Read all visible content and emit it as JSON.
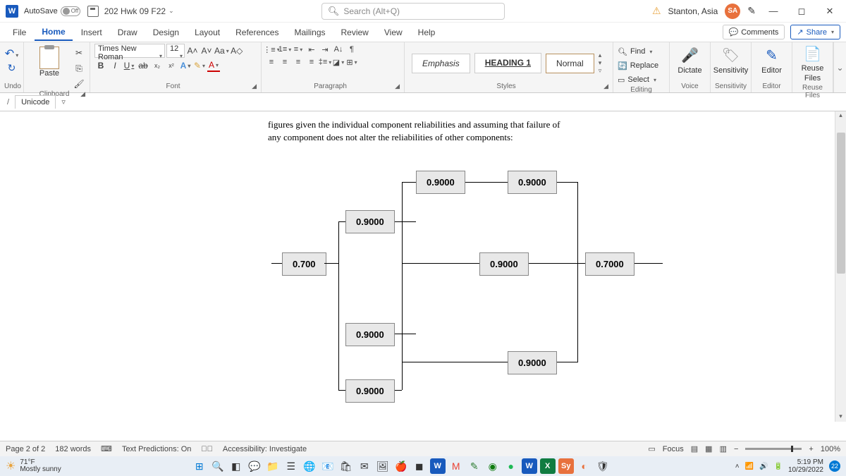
{
  "titlebar": {
    "autosave_label": "AutoSave",
    "autosave_state": "Off",
    "doc_name": "202 Hwk 09 F22",
    "search_placeholder": "Search (Alt+Q)",
    "username": "Stanton, Asia",
    "avatar_initials": "SA"
  },
  "tabs": {
    "file": "File",
    "home": "Home",
    "insert": "Insert",
    "draw": "Draw",
    "design": "Design",
    "layout": "Layout",
    "references": "References",
    "mailings": "Mailings",
    "review": "Review",
    "view": "View",
    "help": "Help",
    "comments": "Comments",
    "share": "Share"
  },
  "ribbon": {
    "undo_label": "Undo",
    "clipboard_label": "Clipboard",
    "paste": "Paste",
    "font_label": "Font",
    "font_name": "Times New Roman",
    "font_size": "12",
    "bold": "B",
    "italic": "I",
    "underline": "U",
    "strike": "ab",
    "sub": "x₂",
    "sup": "x²",
    "grow": "A˄",
    "shrink": "A˅",
    "case": "Aa",
    "clear": "A◇",
    "text_effect": "A",
    "highlight": "✎",
    "font_color": "A",
    "paragraph_label": "Paragraph",
    "styles_label": "Styles",
    "styles": {
      "emphasis": "Emphasis",
      "heading1": "HEADING 1",
      "normal": "Normal"
    },
    "editing_label": "Editing",
    "find": "Find",
    "replace": "Replace",
    "select": "Select",
    "dictate": "Dictate",
    "voice": "Voice",
    "sensitivity": "Sensitivity",
    "sensitivity_label": "Sensitivity",
    "editor": "Editor",
    "editor_label": "Editor",
    "reuse": "Reuse",
    "reuse2": "Files",
    "reuse_label": "Reuse Files"
  },
  "subtab": {
    "unicode": "Unicode"
  },
  "document": {
    "paragraph": "figures given the individual component reliabilities and assuming that failure of any component does not alter the reliabilities of other components:",
    "boxes": {
      "b1": "0.9000",
      "b2": "0.9000",
      "b3": "0.9000",
      "b4": "0.700",
      "b5": "0.9000",
      "b6": "0.7000",
      "b7": "0.9000",
      "b8": "0.9000",
      "b9": "0.9000"
    }
  },
  "status": {
    "page": "Page 2 of 2",
    "words": "182 words",
    "predictions": "Text Predictions: On",
    "accessibility": "Accessibility: Investigate",
    "focus": "Focus",
    "zoom": "100%"
  },
  "taskbar": {
    "temp": "71°F",
    "weather": "Mostly sunny",
    "time": "5:19 PM",
    "date": "10/29/2022",
    "notif": "22"
  }
}
